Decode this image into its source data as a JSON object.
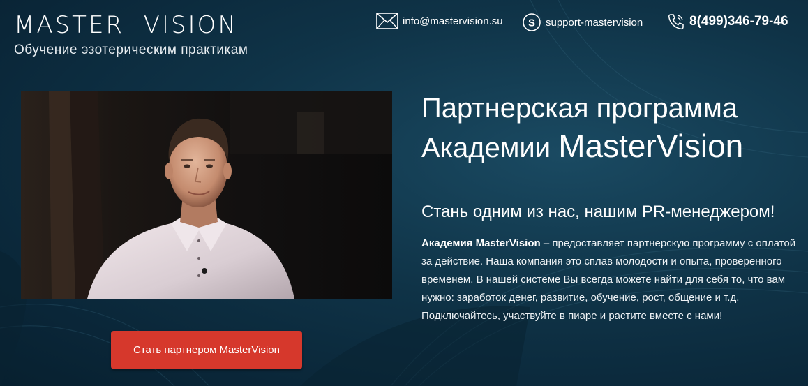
{
  "header": {
    "logo_title": "MASTER  VISION",
    "logo_subtitle": "Обучение эзотерическим практикам",
    "email": "info@mastervision.su",
    "skype": "support-mastervision",
    "phone": "8(499)346-79-46",
    "icons": [
      "envelope-icon",
      "skype-icon",
      "phone-icon"
    ]
  },
  "hero": {
    "headline_line1": "Партнерская программа",
    "headline_line2_prefix": "Академии",
    "headline_brand": "MasterVision",
    "subheadline": "Стань одним из нас, нашим PR-менеджером!",
    "description_bold": "Академия MasterVision",
    "description_rest": " – предоставляет партнерскую программу с оплатой за действие. Наша компания это сплав молодости и опыта, проверенного временем. В нашей системе Вы всегда можете найти для себя то, что вам нужно: заработок денег, развитие, обучение, рост, общение и т.д. Подключайтесь, участвуйте в пиаре и растите вместе с нами!",
    "cta_label": "Стать партнером MasterVision"
  },
  "colors": {
    "background": "#0f3347",
    "cta": "#d6382c",
    "text": "#ffffff"
  }
}
